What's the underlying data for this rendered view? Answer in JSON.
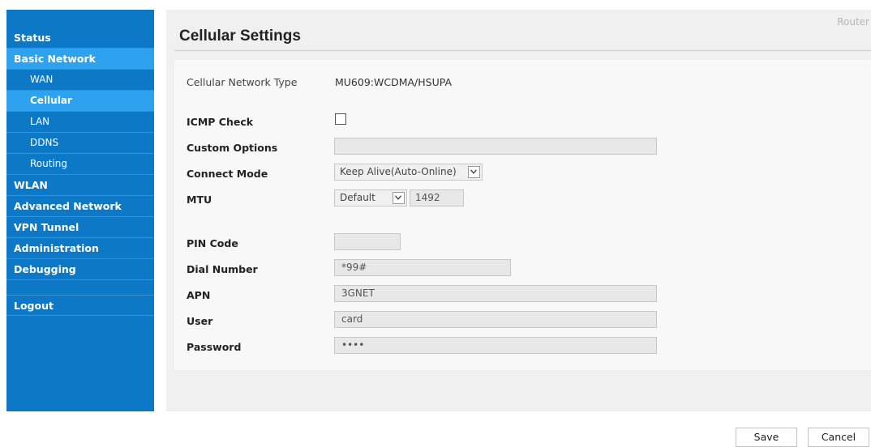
{
  "sidebar": {
    "items": [
      {
        "label": "Status"
      },
      {
        "label": "Basic Network"
      },
      {
        "label": "WAN"
      },
      {
        "label": "Cellular"
      },
      {
        "label": "LAN"
      },
      {
        "label": "DDNS"
      },
      {
        "label": "Routing"
      },
      {
        "label": "WLAN"
      },
      {
        "label": "Advanced Network"
      },
      {
        "label": "VPN Tunnel"
      },
      {
        "label": "Administration"
      },
      {
        "label": "Debugging"
      },
      {
        "label": "Logout"
      }
    ]
  },
  "header": {
    "router_label": "Router",
    "title": "Cellular Settings"
  },
  "form": {
    "network_type": {
      "label": "Cellular Network Type",
      "value": "MU609:WCDMA/HSUPA"
    },
    "icmp_check": {
      "label": "ICMP Check",
      "checked": false
    },
    "custom_options": {
      "label": "Custom Options",
      "value": ""
    },
    "connect_mode": {
      "label": "Connect Mode",
      "selected": "Keep Alive(Auto-Online)"
    },
    "mtu": {
      "label": "MTU",
      "selected": "Default",
      "value": "1492"
    },
    "pin_code": {
      "label": "PIN Code",
      "value": ""
    },
    "dial_number": {
      "label": "Dial Number",
      "value": "*99#"
    },
    "apn": {
      "label": "APN",
      "value": "3GNET"
    },
    "user": {
      "label": "User",
      "value": "card"
    },
    "password": {
      "label": "Password",
      "value": "••••"
    }
  },
  "buttons": {
    "save": "Save",
    "cancel": "Cancel"
  },
  "colors": {
    "sidebar_bg": "#0c78c6",
    "sidebar_active": "#2ea2ee"
  },
  "icons": [
    "chevron-down-icon",
    "checkbox-icon"
  ]
}
